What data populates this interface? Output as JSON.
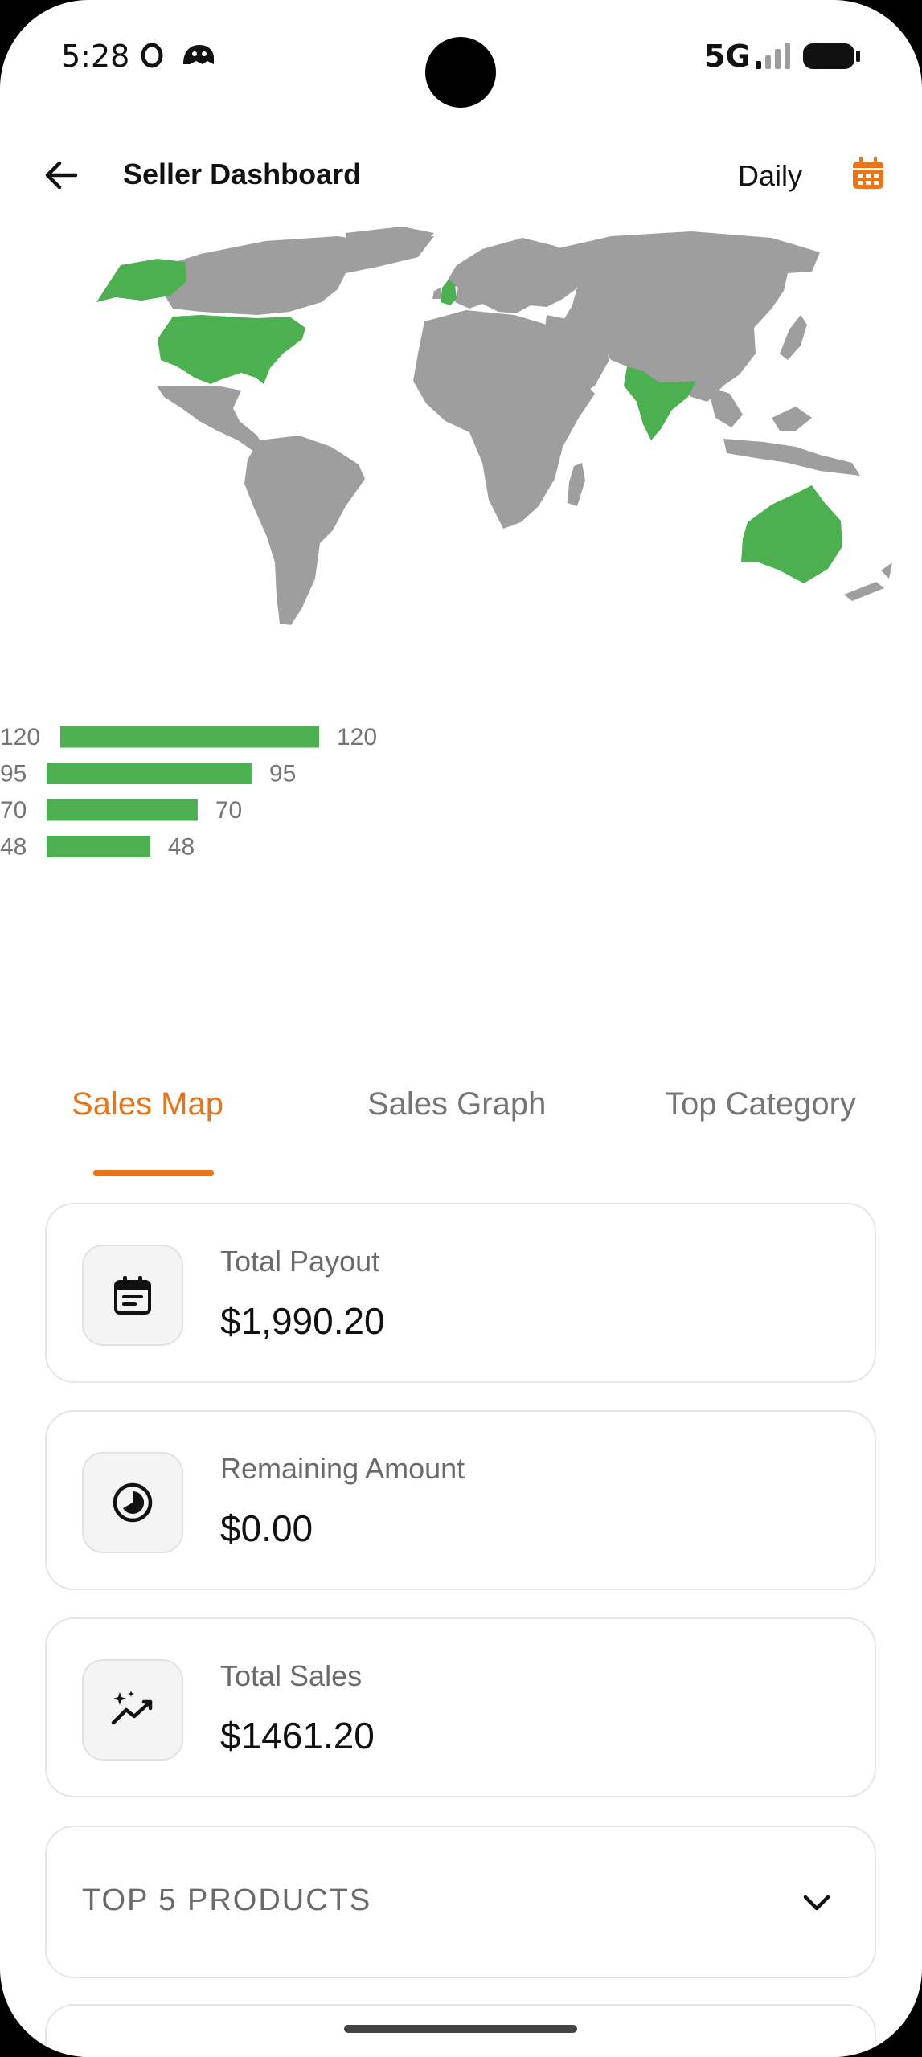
{
  "status_bar": {
    "time": "5:28",
    "network": "5G",
    "icons": [
      "o-app-icon",
      "ghost-app-icon",
      "signal-icon",
      "battery-icon"
    ]
  },
  "app_bar": {
    "title": "Seller Dashboard",
    "period": "Daily",
    "icons": [
      "back-arrow-icon",
      "calendar-icon"
    ]
  },
  "map": {
    "base_color": "#9e9e9e",
    "highlight_color": "#4caf50",
    "highlighted_regions": [
      "United States",
      "Alaska",
      "United Kingdom",
      "India",
      "Australia"
    ]
  },
  "chart_data": {
    "type": "bar",
    "orientation": "horizontal",
    "categories": [
      "120",
      "95",
      "70",
      "48"
    ],
    "values": [
      120,
      95,
      70,
      48
    ],
    "color": "#4caf50",
    "xlim": [
      0,
      120
    ]
  },
  "tabs": [
    {
      "label": "Sales Map",
      "active": true
    },
    {
      "label": "Sales Graph",
      "active": false
    },
    {
      "label": "Top Category",
      "active": false
    }
  ],
  "cards": [
    {
      "label": "Total Payout",
      "value": "$1,990.20",
      "icon": "receipt-icon"
    },
    {
      "label": "Remaining Amount",
      "value": "$0.00",
      "icon": "pie-clock-icon"
    },
    {
      "label": "Total Sales",
      "value": "$1461.20",
      "icon": "sparkle-trend-icon"
    }
  ],
  "top_products": {
    "label": "TOP 5 PRODUCTS",
    "icon": "chevron-down-icon"
  },
  "colors": {
    "accent": "#e8751a",
    "chart_green": "#4caf50",
    "map_gray": "#9e9e9e"
  }
}
